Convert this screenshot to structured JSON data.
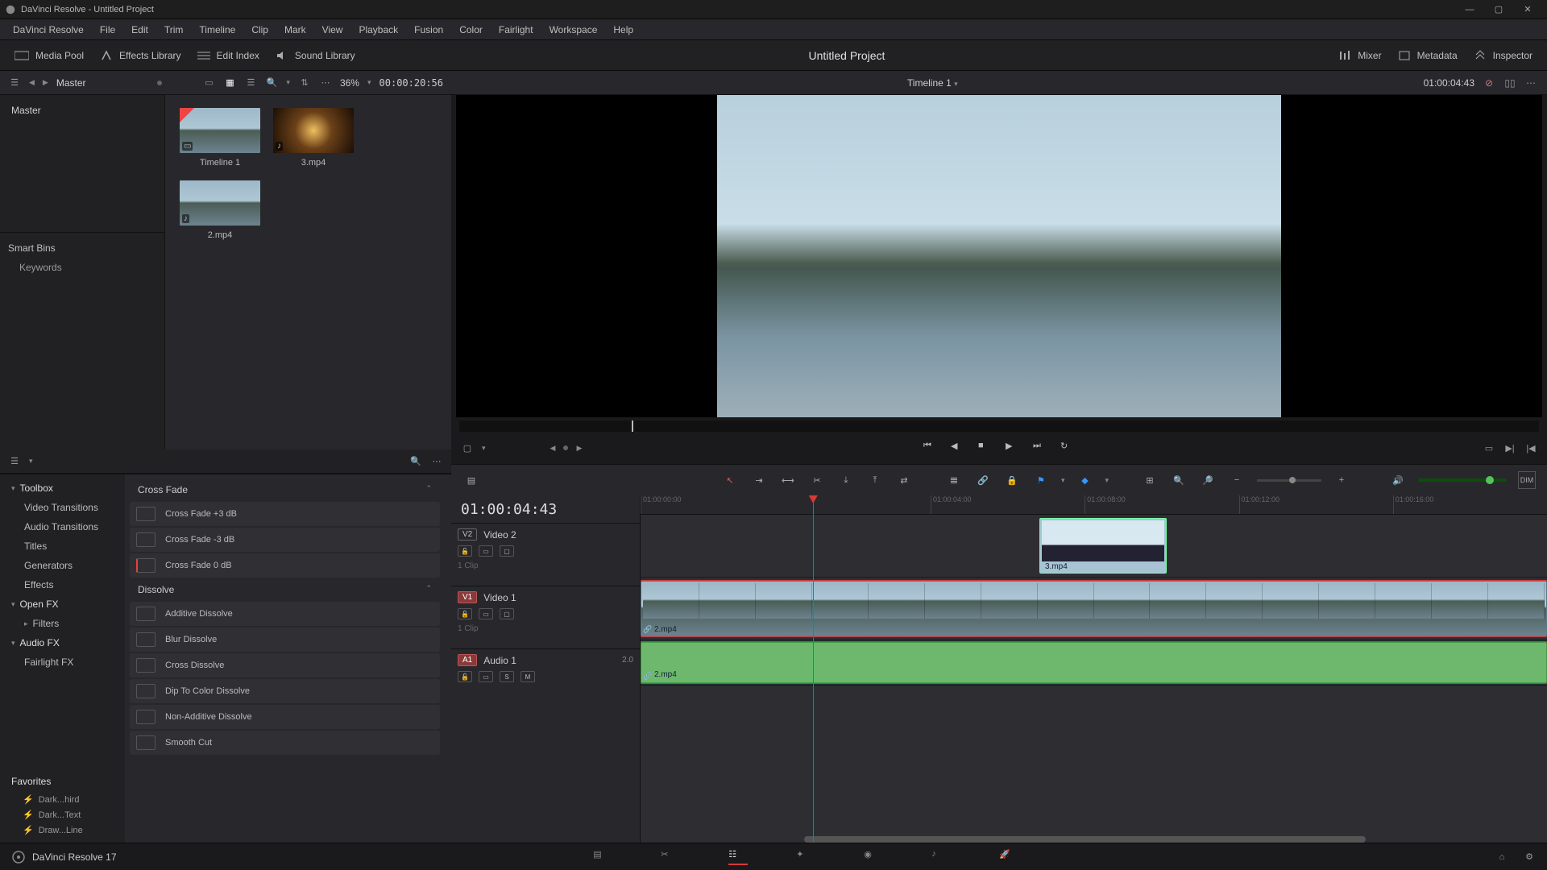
{
  "titlebar": {
    "app": "DaVinci Resolve",
    "doc": "Untitled Project"
  },
  "menubar": [
    "DaVinci Resolve",
    "File",
    "Edit",
    "Trim",
    "Timeline",
    "Clip",
    "Mark",
    "View",
    "Playback",
    "Fusion",
    "Color",
    "Fairlight",
    "Workspace",
    "Help"
  ],
  "topbar": {
    "left": [
      {
        "name": "media-pool",
        "label": "Media Pool"
      },
      {
        "name": "effects-library",
        "label": "Effects Library"
      },
      {
        "name": "edit-index",
        "label": "Edit Index"
      },
      {
        "name": "sound-library",
        "label": "Sound Library"
      }
    ],
    "center": "Untitled Project",
    "right": [
      {
        "name": "mixer",
        "label": "Mixer"
      },
      {
        "name": "metadata",
        "label": "Metadata"
      },
      {
        "name": "inspector",
        "label": "Inspector"
      }
    ]
  },
  "row2": {
    "master": "Master",
    "zoom": "36%",
    "tc_left": "00:00:20:56",
    "timeline_name": "Timeline 1",
    "tc_right": "01:00:04:43"
  },
  "bins": {
    "root": "Master",
    "smart": "Smart Bins",
    "kw": "Keywords"
  },
  "thumbs": [
    {
      "label": "Timeline 1",
      "kind": "timeline"
    },
    {
      "label": "3.mp4",
      "kind": "tunnel"
    },
    {
      "label": "2.mp4",
      "kind": "lake"
    }
  ],
  "fx_tree": {
    "root": "Toolbox",
    "children": [
      "Video Transitions",
      "Audio Transitions",
      "Titles",
      "Generators",
      "Effects"
    ],
    "openfx": "Open FX",
    "filters": "Filters",
    "audiofx": "Audio FX",
    "fairlight": "Fairlight FX",
    "fav_hdr": "Favorites",
    "favs": [
      "Dark...hird",
      "Dark...Text",
      "Draw...Line"
    ]
  },
  "fx_groups": [
    {
      "title": "Cross Fade",
      "items": [
        "Cross Fade +3 dB",
        "Cross Fade -3 dB",
        "Cross Fade 0 dB"
      ]
    },
    {
      "title": "Dissolve",
      "items": [
        "Additive Dissolve",
        "Blur Dissolve",
        "Cross Dissolve",
        "Dip To Color Dissolve",
        "Non-Additive Dissolve",
        "Smooth Cut"
      ]
    }
  ],
  "timeline": {
    "tc": "01:00:04:43",
    "tracks": [
      {
        "tag": "V2",
        "name": "Video 2",
        "clips": "1 Clip"
      },
      {
        "tag": "V1",
        "name": "Video 1",
        "clips": "1 Clip"
      },
      {
        "tag": "A1",
        "name": "Audio 1",
        "ch": "2.0"
      }
    ],
    "clip_v2": "3.mp4",
    "clip_v1": "2.mp4",
    "clip_a1": "2.mp4",
    "ruler": [
      "01:00:00:00",
      "01:00:04:00",
      "01:00:08:00",
      "01:00:12:00",
      "01:00:16:00"
    ]
  },
  "footer": {
    "app": "DaVinci Resolve 17"
  }
}
